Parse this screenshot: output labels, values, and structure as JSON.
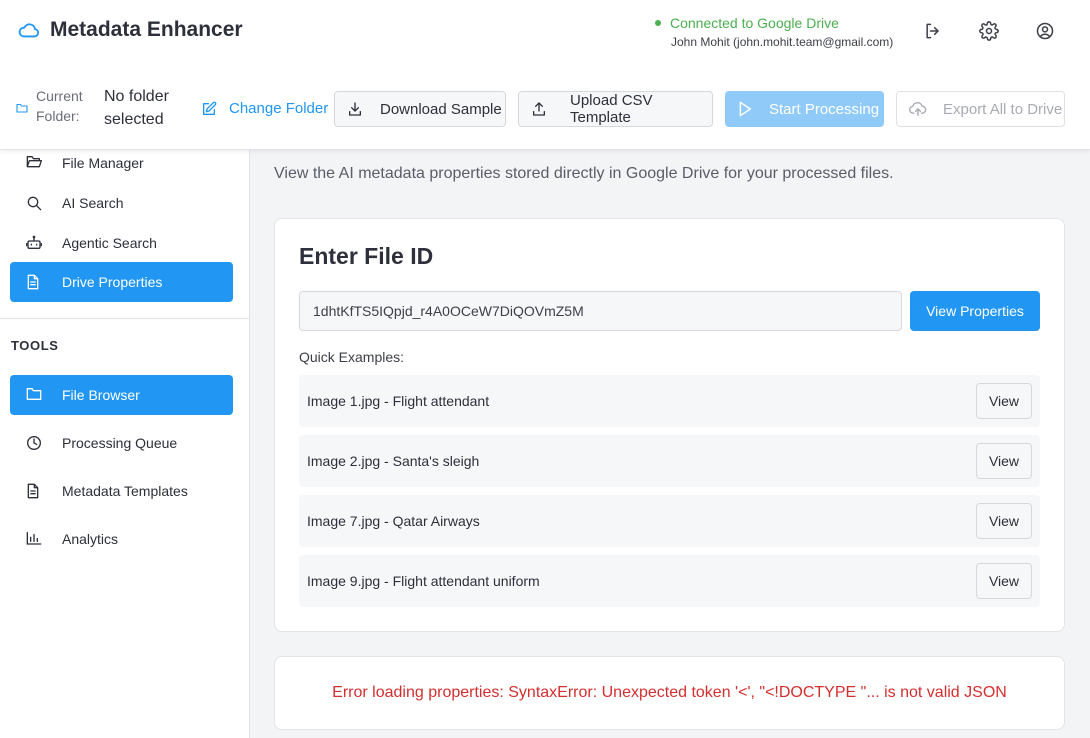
{
  "header": {
    "app_title": "Metadata Enhancer",
    "connection_status": "Connected to Google Drive",
    "user": "John Mohit (john.mohit.team@gmail.com)",
    "icons": [
      "cloud-icon",
      "logout-icon",
      "gear-icon",
      "account-icon"
    ]
  },
  "toolbar": {
    "current_folder_label": "Current Folder:",
    "current_folder_value": "No folder selected",
    "change_folder": "Change Folder",
    "download_sample": "Download Sample",
    "upload_csv": "Upload CSV Template",
    "start_processing": "Start Processing",
    "export_all": "Export All to Drive"
  },
  "sidebar": {
    "items": [
      {
        "label": "File Manager",
        "icon": "folder-open-icon"
      },
      {
        "label": "AI Search",
        "icon": "search-icon"
      },
      {
        "label": "Agentic Search",
        "icon": "robot-icon"
      },
      {
        "label": "Drive Properties",
        "icon": "document-icon",
        "active": true
      }
    ],
    "tools_title": "TOOLS",
    "tools": [
      {
        "label": "File Browser",
        "icon": "folder-icon",
        "active": true
      },
      {
        "label": "Processing Queue",
        "icon": "clock-icon"
      },
      {
        "label": "Metadata Templates",
        "icon": "document-icon"
      },
      {
        "label": "Analytics",
        "icon": "bar-chart-icon"
      }
    ]
  },
  "main": {
    "subtitle": "View the AI metadata properties stored directly in Google Drive for your processed files.",
    "card_title": "Enter File ID",
    "file_id_value": "1dhtKfTS5IQpjd_r4A0OCeW7DiQOVmZ5M",
    "view_properties": "View Properties",
    "quick_examples_label": "Quick Examples:",
    "examples": [
      {
        "text": "Image 1.jpg - Flight attendant",
        "button": "View"
      },
      {
        "text": "Image 2.jpg - Santa's sleigh",
        "button": "View"
      },
      {
        "text": "Image 7.jpg - Qatar Airways",
        "button": "View"
      },
      {
        "text": "Image 9.jpg - Flight attendant uniform",
        "button": "View"
      }
    ],
    "error": "Error loading properties: SyntaxError: Unexpected token '<', \"<!DOCTYPE \"... is not valid JSON"
  },
  "colors": {
    "accent": "#2196f3",
    "accent_disabled": "#90caf9",
    "connected": "#4caf50",
    "error": "#d32f2f"
  }
}
